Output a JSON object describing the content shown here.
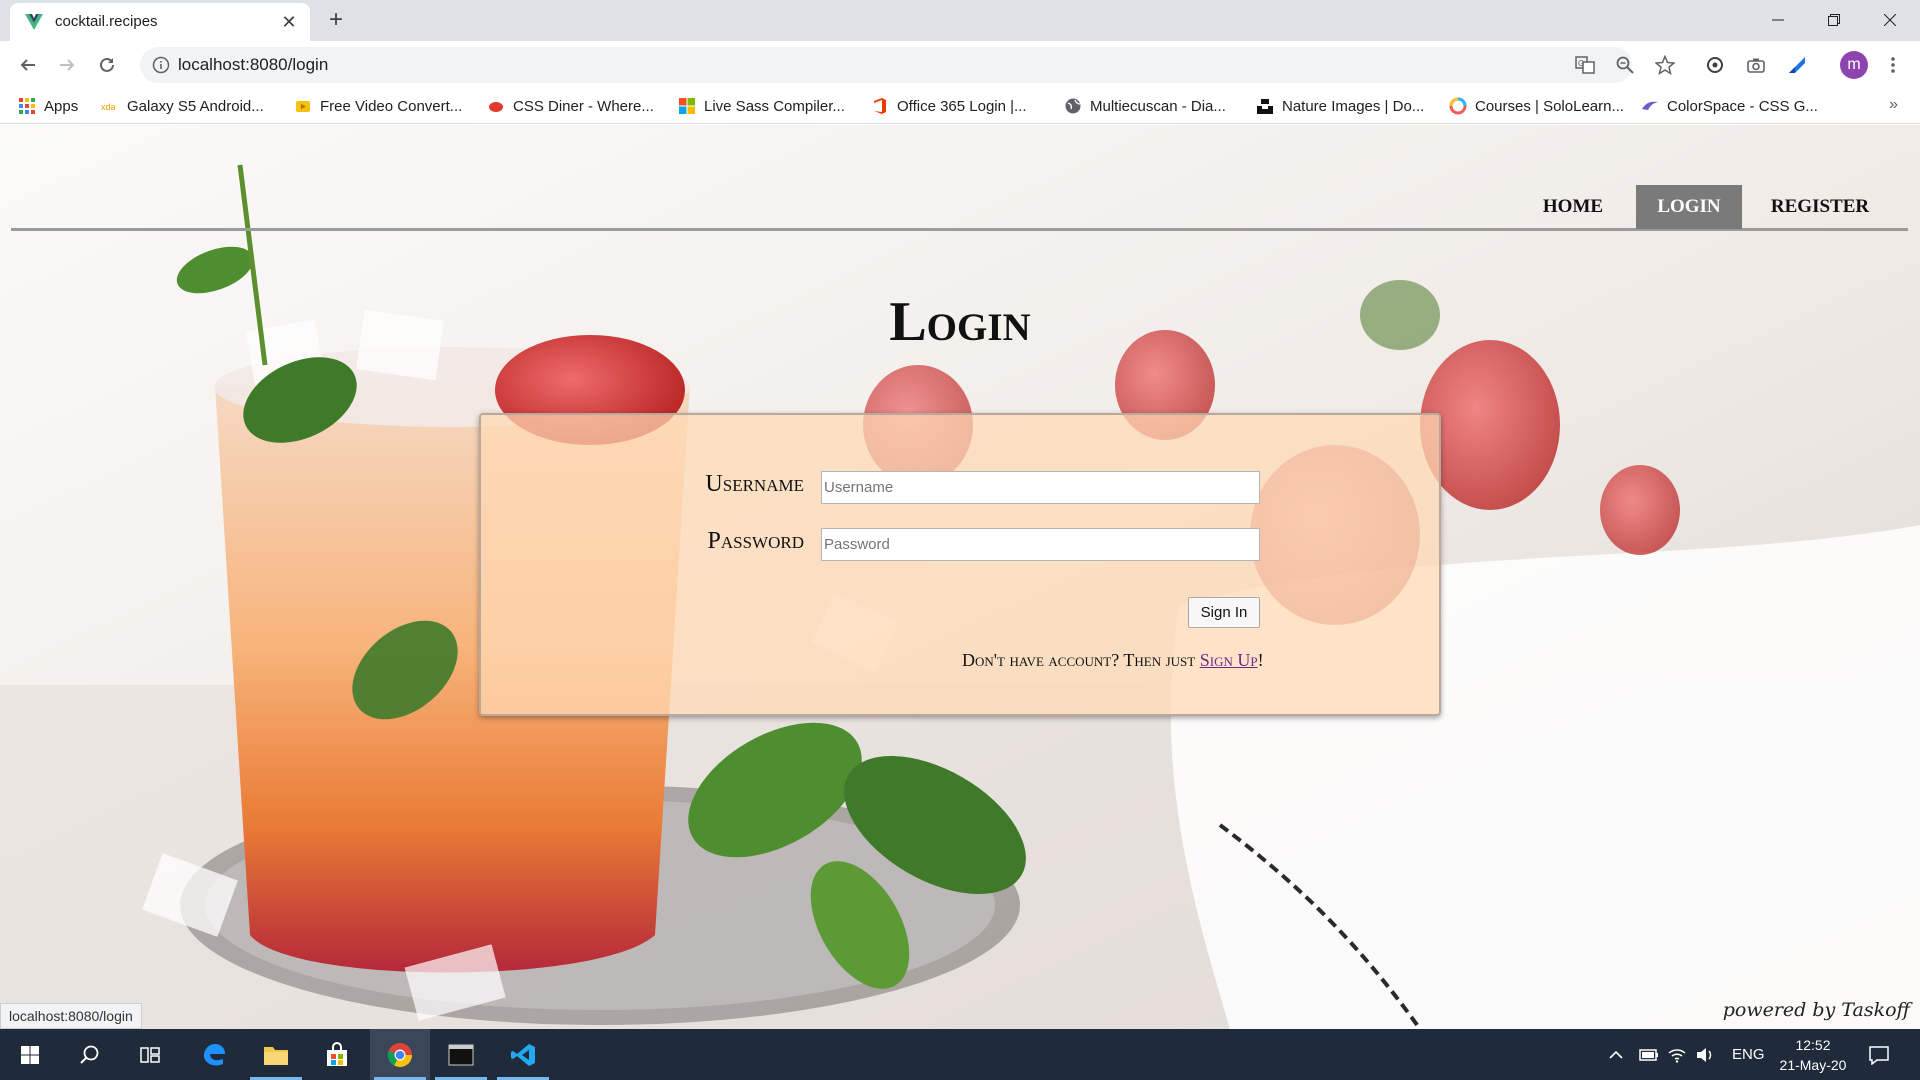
{
  "browser": {
    "tab_title": "cocktail.recipes",
    "url": "localhost:8080/login",
    "bookmarks": [
      {
        "label": "Apps"
      },
      {
        "label": "Galaxy S5 Android..."
      },
      {
        "label": "Free Video Convert..."
      },
      {
        "label": "CSS Diner - Where..."
      },
      {
        "label": "Live Sass Compiler..."
      },
      {
        "label": "Office 365 Login |..."
      },
      {
        "label": "Multiecuscan - Dia..."
      },
      {
        "label": "Nature Images | Do..."
      },
      {
        "label": "Courses | SoloLearn..."
      },
      {
        "label": "ColorSpace - CSS G..."
      }
    ],
    "bookmarks_more": "»",
    "profile_initial": "m",
    "status_url": "localhost:8080/login"
  },
  "nav": {
    "home": "HOME",
    "login": "LOGIN",
    "register": "REGISTER",
    "active": "LOGIN"
  },
  "page": {
    "title": "Login",
    "username_label": "Username",
    "username_placeholder": "Username",
    "password_label": "Password",
    "password_placeholder": "Password",
    "signin_label": "Sign In",
    "signup_prefix": "Don't have account? Then just ",
    "signup_link": "Sign Up",
    "signup_suffix": "!",
    "powered_by": "powered by Taskoff"
  },
  "taskbar": {
    "language": "ENG",
    "time": "12:52",
    "date": "21-May-20"
  },
  "colors": {
    "panel": "#ffdab4",
    "nav_active": "#7a7a7a",
    "link": "#6b2a8c",
    "taskbar": "#1f2a3a"
  }
}
